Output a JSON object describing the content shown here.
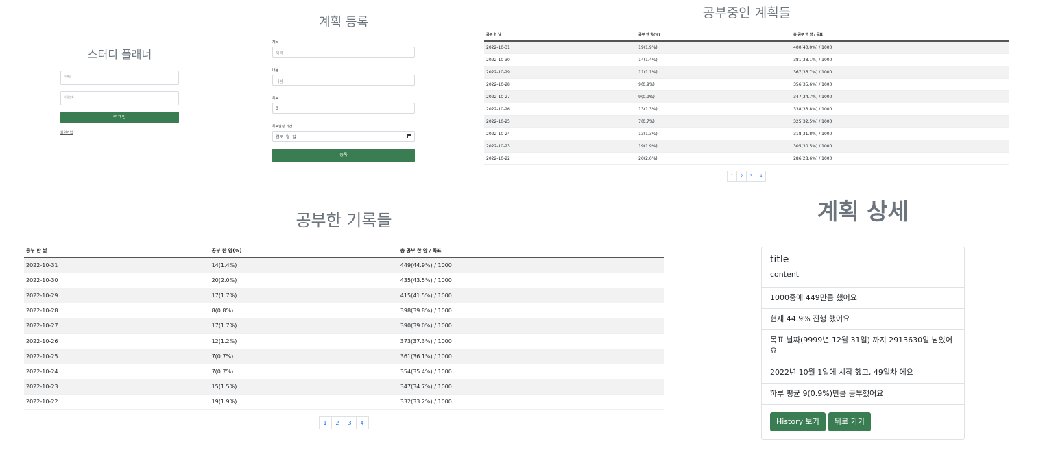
{
  "login": {
    "title": "스터디 플래너",
    "email_placeholder": "이메일",
    "password_placeholder": "비밀번호",
    "login_button": "로그인",
    "signup_link": "회원가입"
  },
  "register": {
    "title": "계획 등록",
    "title_label": "제목",
    "title_placeholder": "제목",
    "content_label": "내용",
    "content_placeholder": "내용",
    "goal_label": "목표",
    "goal_value": "0",
    "period_label": "목표달성 기간",
    "period_placeholder": "연도. 월. 일.",
    "submit_button": "등록"
  },
  "inprogress": {
    "title": "공부중인 계획들",
    "headers": [
      "공부 한 날",
      "공부 한 양(%)",
      "총 공부 한 양 / 목표"
    ],
    "rows": [
      [
        "2022-10-31",
        "19(1.9%)",
        "400(40.0%) / 1000"
      ],
      [
        "2022-10-30",
        "14(1.4%)",
        "381(38.1%) / 1000"
      ],
      [
        "2022-10-29",
        "11(1.1%)",
        "367(36.7%) / 1000"
      ],
      [
        "2022-10-28",
        "9(0.9%)",
        "356(35.6%) / 1000"
      ],
      [
        "2022-10-27",
        "9(0.9%)",
        "347(34.7%) / 1000"
      ],
      [
        "2022-10-26",
        "13(1.3%)",
        "338(33.8%) / 1000"
      ],
      [
        "2022-10-25",
        "7(0.7%)",
        "325(32.5%) / 1000"
      ],
      [
        "2022-10-24",
        "13(1.3%)",
        "318(31.8%) / 1000"
      ],
      [
        "2022-10-23",
        "19(1.9%)",
        "305(30.5%) / 1000"
      ],
      [
        "2022-10-22",
        "20(2.0%)",
        "286(28.6%) / 1000"
      ]
    ],
    "pages": [
      "1",
      "2",
      "3",
      "4"
    ]
  },
  "records": {
    "title": "공부한 기록들",
    "headers": [
      "공부 한 날",
      "공부 한 양(%)",
      "총 공부 한 양 / 목표"
    ],
    "rows": [
      [
        "2022-10-31",
        "14(1.4%)",
        "449(44.9%) / 1000"
      ],
      [
        "2022-10-30",
        "20(2.0%)",
        "435(43.5%) / 1000"
      ],
      [
        "2022-10-29",
        "17(1.7%)",
        "415(41.5%) / 1000"
      ],
      [
        "2022-10-28",
        "8(0.8%)",
        "398(39.8%) / 1000"
      ],
      [
        "2022-10-27",
        "17(1.7%)",
        "390(39.0%) / 1000"
      ],
      [
        "2022-10-26",
        "12(1.2%)",
        "373(37.3%) / 1000"
      ],
      [
        "2022-10-25",
        "7(0.7%)",
        "361(36.1%) / 1000"
      ],
      [
        "2022-10-24",
        "7(0.7%)",
        "354(35.4%) / 1000"
      ],
      [
        "2022-10-23",
        "15(1.5%)",
        "347(34.7%) / 1000"
      ],
      [
        "2022-10-22",
        "19(1.9%)",
        "332(33.2%) / 1000"
      ]
    ],
    "pages": [
      "1",
      "2",
      "3",
      "4"
    ]
  },
  "detail": {
    "title": "계획 상세",
    "plan_title": "title",
    "plan_content": "content",
    "progress_amount": "1000중에 449만큼 했어요",
    "progress_percent": "현재 44.9% 진행 했어요",
    "days_left": "목표 날짜(9999년 12월 31일) 까지 2913630일 남았어요",
    "started": "2022년 10월 1일에 시작 했고, 49일차 에요",
    "average": "하루 평균 9(0.9%)만큼 공부했어요",
    "history_button": "History 보기",
    "back_button": "뒤로 가기"
  },
  "colors": {
    "primary_green": "#3b7d52",
    "link_blue": "#0d6efd",
    "title_gray": "#6c757d"
  }
}
